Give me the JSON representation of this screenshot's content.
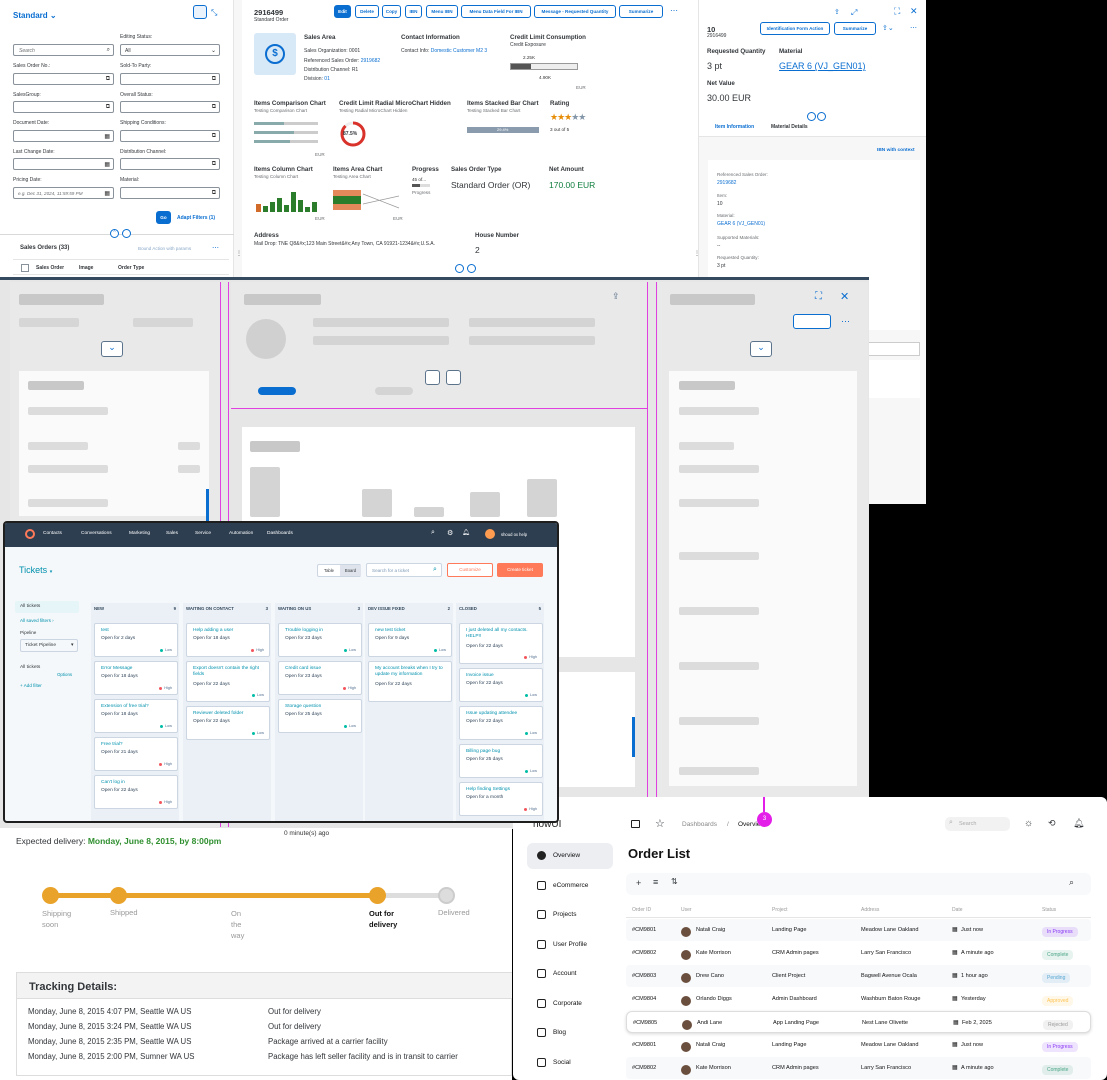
{
  "sap": {
    "variant": "Standard",
    "filters": {
      "search_placeholder": "Search",
      "editing_status_label": "Editing Status:",
      "editing_status_value": "All",
      "sales_order_no": "Sales Order No.:",
      "sold_to_party": "Sold-To Party:",
      "sales_group": "SalesGroup:",
      "overall_status": "Overall Status:",
      "document_date": "Document Date:",
      "shipping_conditions": "Shipping Conditions:",
      "last_change_date": "Last Change Date:",
      "distribution_channel": "Distribution Channel:",
      "pricing_date": "Pricing Date:",
      "material": "Material:",
      "pricing_date_placeholder": "e.g. Dec 31, 2024, 11:59:59 PM",
      "go": "Go",
      "adapt": "Adapt Filters (1)"
    },
    "table": {
      "title": "Sales Orders (33)",
      "bound_action": "Bound Action with params",
      "col_so": "Sales Order",
      "col_image": "Image",
      "col_type": "Order Type"
    },
    "object": {
      "id": "2916499",
      "subtitle": "Standard Order",
      "actions": [
        "Edit",
        "Delete",
        "Copy",
        "IBN",
        "Menu IBN",
        "Menu Data Field For IBN",
        "Message - Requested Quantity",
        "Summarize"
      ],
      "sales_area_title": "Sales Area",
      "sales_org_label": "Sales Organization:",
      "sales_org": "0001",
      "ref_so_label": "Referenced Sales Order:",
      "ref_so": "2919682",
      "dist_channel_label": "Distribution Channel:",
      "dist_channel": "R1",
      "division_label": "Division:",
      "division": "01",
      "contact_title": "Contact Information",
      "contact_label": "Contact Info:",
      "contact_value": "Domestic Customer M2 3",
      "credit_title": "Credit Limit Consumption",
      "credit_sub": "Credit Exposure",
      "credit_v1": "2.25K",
      "credit_v2": "4.90K",
      "credit_unit": "EUR",
      "items_comp_title": "Items Comparison Chart",
      "items_comp_sub": "Testing Comparison Chart",
      "items_comp_unit": "EUR",
      "radial_title": "Credit Limit Radial MicroChart Hidden",
      "radial_sub": "Testing Radial MicroChart Hidden",
      "radial_value": "87.5%",
      "stacked_title": "Items Stacked Bar Chart",
      "stacked_sub": "Testing Stacked Bar Chart",
      "stacked_value": "29.4%",
      "rating_title": "Rating",
      "rating_text": "3 out of 5",
      "col_chart_title": "Items Column Chart",
      "col_chart_sub": "Testing Column Chart",
      "col_chart_unit": "EUR",
      "area_chart_title": "Items Area Chart",
      "area_chart_sub": "Testing Area Chart",
      "area_chart_unit": "EUR",
      "progress_title": "Progress",
      "progress_value": "45 of...",
      "progress_label": "Progress",
      "so_type_title": "Sales Order Type",
      "so_type": "Standard Order (OR)",
      "net_title": "Net Amount",
      "net_value": "170.00 EUR",
      "address_title": "Address",
      "address": "Mail Drop: TNE Q8&#x;123 Main Street&#x;Any Town, CA 91921-1234&#x;U.S.A.",
      "house_title": "House Number",
      "house": "2"
    },
    "item": {
      "id": "10",
      "sub": "2916499",
      "id_form": "Identification Form Action",
      "summarize": "Summarize",
      "req_qty_label": "Requested Quantity",
      "req_qty": "3 pt",
      "material_label": "Material",
      "material": "GEAR 6 (VJ_GEN01)",
      "net_label": "Net Value",
      "net": "30.00 EUR",
      "tab1": "Item Information",
      "tab2": "Material Details",
      "ibn": "IBN with context",
      "ref_label": "Referenced Sales Order:",
      "ref": "2919682",
      "item_label": "Item:",
      "item": "10",
      "mat_label": "Material:",
      "mat": "GEAR 6 (VJ_GEN01)",
      "supp_label": "Supported Materials:",
      "supp": "--",
      "rq_label": "Requested Quantity:",
      "rq": "3 pt"
    }
  },
  "hubspot": {
    "nav": [
      "Contacts",
      "Conversations",
      "Marketing",
      "Sales",
      "Service",
      "Automation",
      "Dashboards"
    ],
    "user": "shoud ox help",
    "title": "Tickets",
    "view_table": "Table",
    "view_board": "Board",
    "search_placeholder": "Search for a ticket",
    "customize": "Customize",
    "create": "Create ticket",
    "side": {
      "all": "All tickets",
      "saved": "All saved filters",
      "pipeline_label": "Pipeline",
      "pipeline": "Ticket Pipeline",
      "all2": "All tickets",
      "options": "Options",
      "add_filter": "+ Add filter"
    },
    "columns": [
      {
        "name": "NEW",
        "count": "9",
        "cards": [
          {
            "t": "test",
            "s": "Open for 2 days",
            "p": "Low",
            "c": "#00bda5"
          },
          {
            "t": "Error Message",
            "s": "Open for 18 days",
            "p": "High",
            "c": "#f2545b"
          },
          {
            "t": "Extension of free trial?",
            "s": "Open for 18 days",
            "p": "Low",
            "c": "#00bda5"
          },
          {
            "t": "Free trial?",
            "s": "Open for 21 days",
            "p": "High",
            "c": "#f2545b"
          },
          {
            "t": "Can't log in",
            "s": "Open for 22 days",
            "p": "High",
            "c": "#f2545b"
          }
        ]
      },
      {
        "name": "WAITING ON CONTACT",
        "count": "3",
        "cards": [
          {
            "t": "Help adding a user",
            "s": "Open for 18 days",
            "p": "High",
            "c": "#f2545b"
          },
          {
            "t": "Export doesn't contain the right fields",
            "s": "Open for 22 days",
            "p": "Low",
            "c": "#00bda5"
          },
          {
            "t": "Reviewer deleted folder",
            "s": "Open for 22 days",
            "p": "Low",
            "c": "#00bda5"
          }
        ]
      },
      {
        "name": "WAITING ON US",
        "count": "3",
        "cards": [
          {
            "t": "Trouble logging in",
            "s": "Open for 23 days",
            "p": "Low",
            "c": "#00bda5"
          },
          {
            "t": "Credit card issue",
            "s": "Open for 23 days",
            "p": "High",
            "c": "#f2545b"
          },
          {
            "t": "Storage question",
            "s": "Open for 25 days",
            "p": "Low",
            "c": "#00bda5"
          }
        ]
      },
      {
        "name": "DEV ISSUE FIXED",
        "count": "2",
        "cards": [
          {
            "t": "new test ticket",
            "s": "Open for 9 days",
            "p": "Low",
            "c": "#00bda5"
          },
          {
            "t": "My account breaks when I try to update my information",
            "s": "Open for 22 days",
            "p": "",
            "c": ""
          }
        ]
      },
      {
        "name": "CLOSED",
        "count": "5",
        "cards": [
          {
            "t": "I just deleted all my contacts. HELP!!",
            "s": "Open for 22 days",
            "p": "High",
            "c": "#f2545b"
          },
          {
            "t": "Invoice issue",
            "s": "Open for 22 days",
            "p": "Low",
            "c": "#00bda5"
          },
          {
            "t": "Issue updating attendee",
            "s": "Open for 22 days",
            "p": "Low",
            "c": "#00bda5"
          },
          {
            "t": "Billing page bug",
            "s": "Open for 25 days",
            "p": "Low",
            "c": "#00bda5"
          },
          {
            "t": "Help finding Settings",
            "s": "Open for a month",
            "p": "High",
            "c": "#f2545b"
          }
        ]
      }
    ]
  },
  "tracking": {
    "expected_label": "Expected delivery:",
    "expected": "Monday, June 8, 2015, by 8:00pm",
    "updated": "0 minute(s) ago",
    "steps": [
      "Shipping soon",
      "Shipped",
      "On the way",
      "Out for delivery",
      "Delivered"
    ],
    "details_title": "Tracking Details:",
    "rows": [
      [
        "Monday, June 8, 2015 4:07 PM, Seattle WA US",
        "Out for delivery"
      ],
      [
        "Monday, June 8, 2015 3:24 PM, Seattle WA US",
        "Out for delivery"
      ],
      [
        "Monday, June 8, 2015 2:35 PM, Seattle WA US",
        "Package arrived at a carrier facility"
      ],
      [
        "Monday, June 8, 2015 2:00 PM, Sumner WA US",
        "Package has left seller facility and is in transit to carrier"
      ]
    ]
  },
  "orders": {
    "logo": "howUI",
    "crumb1": "Dashboards",
    "crumb2": "Overview",
    "badge": "3",
    "search": "Search",
    "nav": [
      "Overview",
      "eCommerce",
      "Projects",
      "User Profile",
      "Account",
      "Corporate",
      "Blog",
      "Social"
    ],
    "title": "Order List",
    "headers": [
      "Order ID",
      "User",
      "Project",
      "Address",
      "Date",
      "Status"
    ],
    "rows": [
      [
        "#CM9801",
        "Natali Craig",
        "Landing Page",
        "Meadow Lane Oakland",
        "Just now",
        "In Progress"
      ],
      [
        "#CM9802",
        "Kate Morrison",
        "CRM Admin pages",
        "Larry San Francisco",
        "A minute ago",
        "Complete"
      ],
      [
        "#CM9803",
        "Drew Cano",
        "Client Project",
        "Bagwell Avenue Ocala",
        "1 hour ago",
        "Pending"
      ],
      [
        "#CM9804",
        "Orlando Diggs",
        "Admin Dashboard",
        "Washburn Baton Rouge",
        "Yesterday",
        "Approved"
      ],
      [
        "#CM9805",
        "Andi Lane",
        "App Landing Page",
        "Nest Lane Olivette",
        "Feb 2, 2025",
        "Rejected"
      ],
      [
        "#CM9801",
        "Natali Craig",
        "Landing Page",
        "Meadow Lane Oakland",
        "Just now",
        "In Progress"
      ],
      [
        "#CM9802",
        "Kate Morrison",
        "CRM Admin pages",
        "Larry San Francisco",
        "A minute ago",
        "Complete"
      ]
    ],
    "status_colors": {
      "In Progress": "#8a38f5",
      "Complete": "#4aa785",
      "Pending": "#59a8d4",
      "Approved": "#ffc555",
      "Rejected": "#999999"
    }
  }
}
